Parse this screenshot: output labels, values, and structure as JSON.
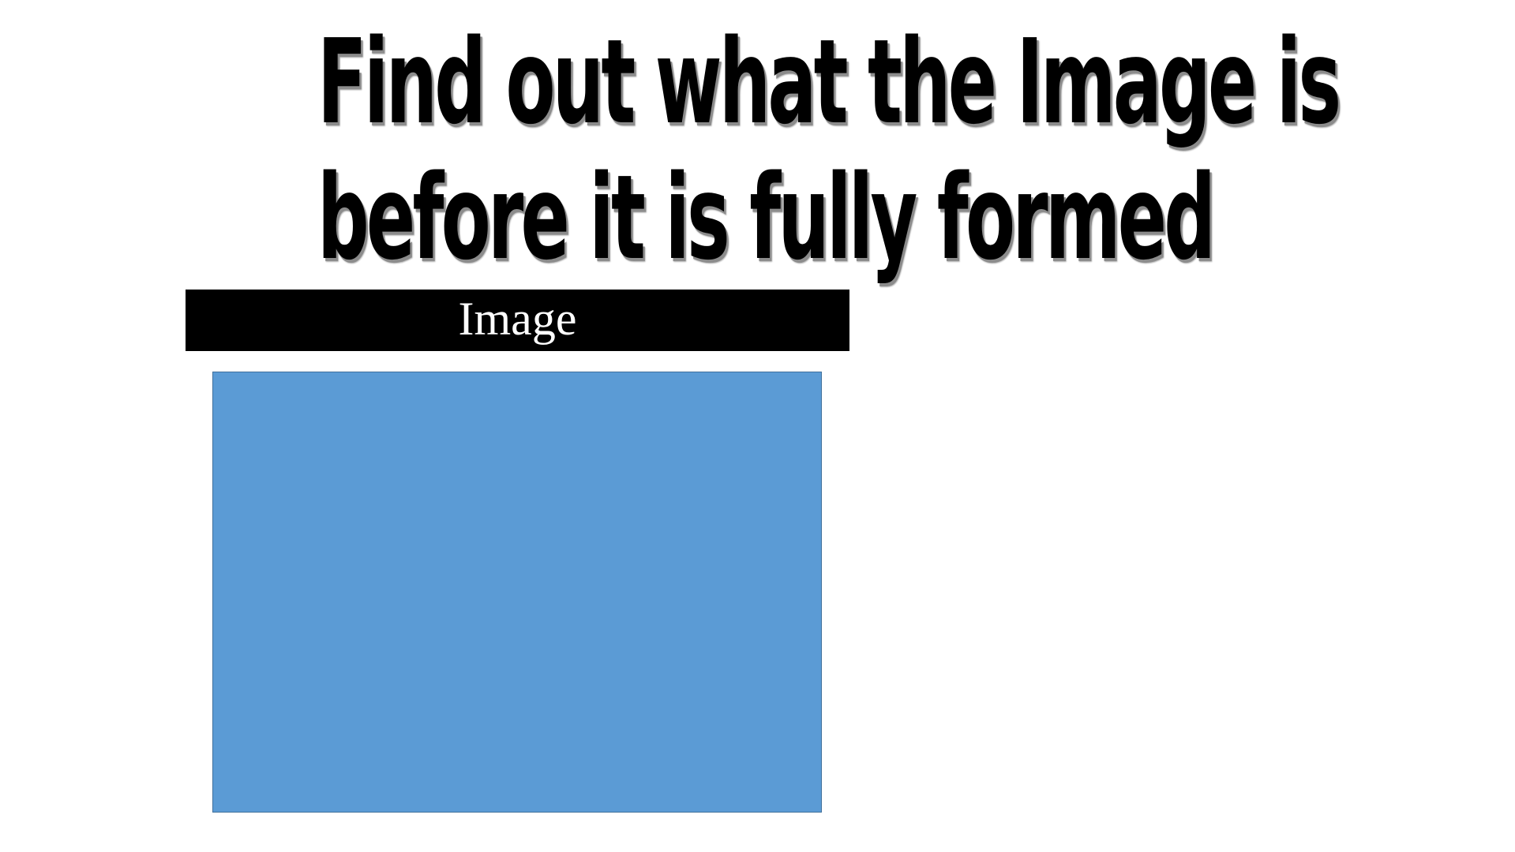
{
  "slide": {
    "title_line_1": "Find out what the Image is",
    "title_line_2": "before it is fully formed",
    "image_label": "Image",
    "colors": {
      "background": "#ffffff",
      "title_text": "#000000",
      "label_bar": "#000000",
      "label_text": "#ffffff",
      "image_fill": "#5b9bd5",
      "image_border": "#41719c"
    }
  }
}
